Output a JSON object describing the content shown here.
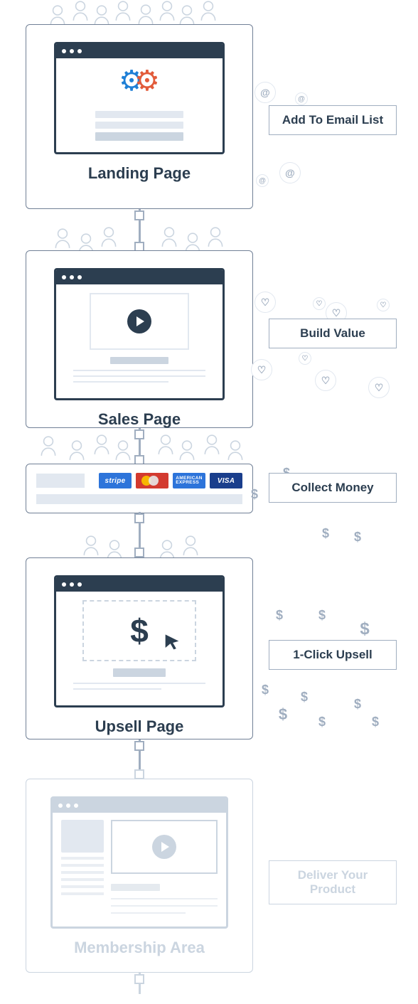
{
  "funnel": {
    "steps": [
      {
        "key": "landing",
        "label": "Landing Page",
        "result": "Add To Email List"
      },
      {
        "key": "sales",
        "label": "Sales Page",
        "result": "Build Value"
      },
      {
        "key": "checkout",
        "label": "",
        "result": "Collect Money",
        "payment_brands": [
          "stripe",
          "mastercard",
          "amex",
          "visa"
        ]
      },
      {
        "key": "upsell",
        "label": "Upsell Page",
        "result": "1-Click Upsell"
      },
      {
        "key": "membership",
        "label": "Membership Area",
        "result": "Deliver Your Product",
        "faded": true
      }
    ]
  },
  "decor": {
    "email_icon": "@",
    "heart_icon": "♡",
    "dollar_icon": "$"
  }
}
